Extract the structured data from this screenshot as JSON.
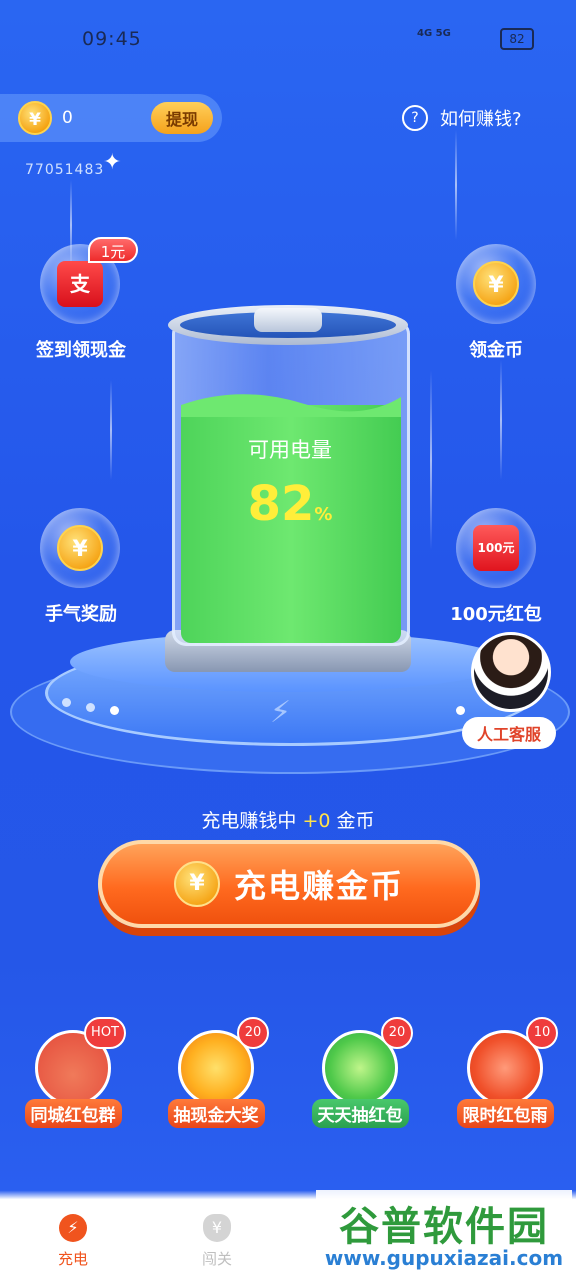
{
  "status_bar": {
    "time": "09:45",
    "network": "4G 5G",
    "battery": "82"
  },
  "header": {
    "coin_symbol": "¥",
    "balance": "0",
    "withdraw_label": "提现",
    "user_id": "77051483",
    "help_icon": "?",
    "help_label": "如何赚钱?"
  },
  "bubbles": {
    "checkin": {
      "label": "签到领现金",
      "tag": "1元",
      "glyph": "支",
      "icon": "alipay-redpack-icon"
    },
    "collect_coins": {
      "label": "领金币",
      "glyph": "¥",
      "icon": "gold-coin-icon"
    },
    "luck": {
      "label": "手气奖励",
      "glyph": "¥",
      "icon": "gold-coin-icon"
    },
    "redpack100": {
      "label": "100元红包",
      "glyph": "100元",
      "icon": "red-envelope-icon"
    }
  },
  "battery": {
    "label": "可用电量",
    "percent": "82",
    "percent_unit": "%",
    "level": 0.82
  },
  "customer_service": {
    "label": "人工客服"
  },
  "charging": {
    "prefix": "充电赚钱中",
    "amount": "+0",
    "suffix": "金币",
    "button_label": "充电赚金币",
    "coin_symbol": "¥"
  },
  "features": [
    {
      "label": "同城红包群",
      "badge": "HOT",
      "icon": "red-building-icon"
    },
    {
      "label": "抽现金大奖",
      "badge": "20",
      "icon": "prize-wheel-icon"
    },
    {
      "label": "天天抽红包",
      "badge": "20",
      "icon": "green-redpack-icon"
    },
    {
      "label": "限时红包雨",
      "badge": "10",
      "icon": "redpack-rain-icon"
    }
  ],
  "tabs": [
    {
      "label": "充电",
      "icon": "lightning-icon",
      "active": true
    },
    {
      "label": "闯关",
      "icon": "money-bag-icon",
      "active": false
    }
  ],
  "watermark": {
    "title": "谷普软件园",
    "url": "www.gupuxiazai.com"
  },
  "colors": {
    "bg": "#2557e8",
    "accent_orange": "#ff6a1f",
    "battery_green": "#5ad85e",
    "percent_yellow": "#ffee3a"
  }
}
